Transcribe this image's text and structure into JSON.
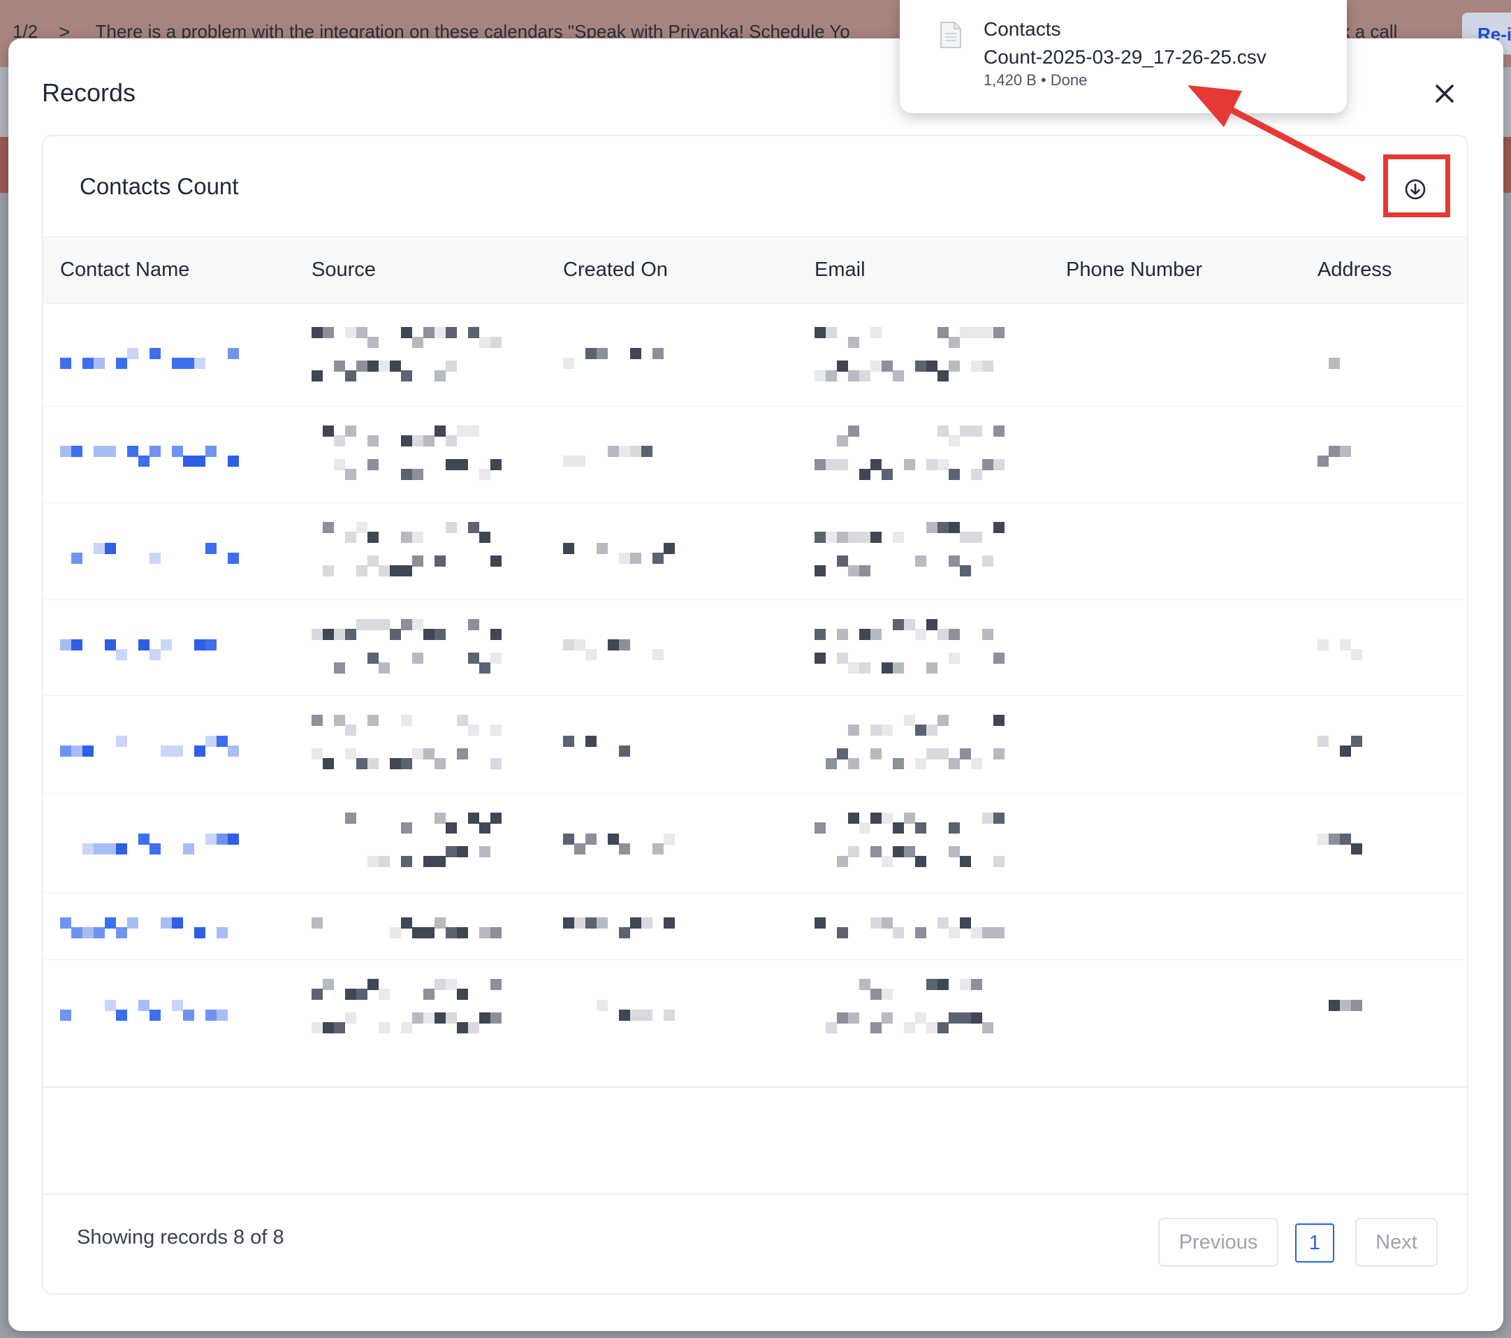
{
  "banner": {
    "pager": "1/2",
    "chevron": ">",
    "message": "There is a problem with the integration on these calendars \"Speak with Priyanka! Schedule Yo",
    "message_tail": "ok a call",
    "action": "Re-i"
  },
  "modal": {
    "title": "Records",
    "close_icon": "close-icon"
  },
  "card": {
    "title": "Contacts Count",
    "download_icon": "download-icon"
  },
  "table": {
    "columns": [
      "Contact Name",
      "Source",
      "Created On",
      "Email",
      "Phone Number",
      "Address"
    ],
    "rows": [
      {
        "name": "[redacted]",
        "source": "[redacted]",
        "created_on": "[redacted]",
        "email": "[redacted]",
        "phone": "",
        "address": "[redacted]"
      },
      {
        "name": "[redacted]",
        "source": "[redacted]",
        "created_on": "[redacted]",
        "email": "[redacted]",
        "phone": "",
        "address": "[redacted]"
      },
      {
        "name": "[redacted]",
        "source": "[redacted]",
        "created_on": "[redacted]",
        "email": "[redacted]",
        "phone": "",
        "address": ""
      },
      {
        "name": "[redacted]",
        "source": "[redacted]",
        "created_on": "[redacted]",
        "email": "[redacted]",
        "phone": "",
        "address": "[redacted]"
      },
      {
        "name": "[redacted]",
        "source": "[redacted]",
        "created_on": "[redacted]",
        "email": "[redacted]",
        "phone": "",
        "address": "[redacted]"
      },
      {
        "name": "[redacted]",
        "source": "[redacted]",
        "created_on": "[redacted]",
        "email": "[redacted]",
        "phone": "",
        "address": "[redacted]"
      },
      {
        "name": "[redacted]",
        "source": "[redacted]",
        "created_on": "[redacted]",
        "email": "[redacted]",
        "phone": "",
        "address": ""
      },
      {
        "name": "[redacted]",
        "source": "[redacted]",
        "created_on": "[redacted]",
        "email": "[redacted]",
        "phone": "",
        "address": "[redacted]"
      }
    ]
  },
  "footer": {
    "showing": "Showing records 8 of 8",
    "previous": "Previous",
    "page": "1",
    "next": "Next"
  },
  "download": {
    "file_icon": "file-icon",
    "filename_line1": "Contacts",
    "filename_line2": "Count-2025-03-29_17-26-25.csv",
    "meta": "1,420 B • Done"
  },
  "colors": {
    "accent": "#2563eb",
    "annotation": "#e53935",
    "banner": "#a8847f"
  }
}
